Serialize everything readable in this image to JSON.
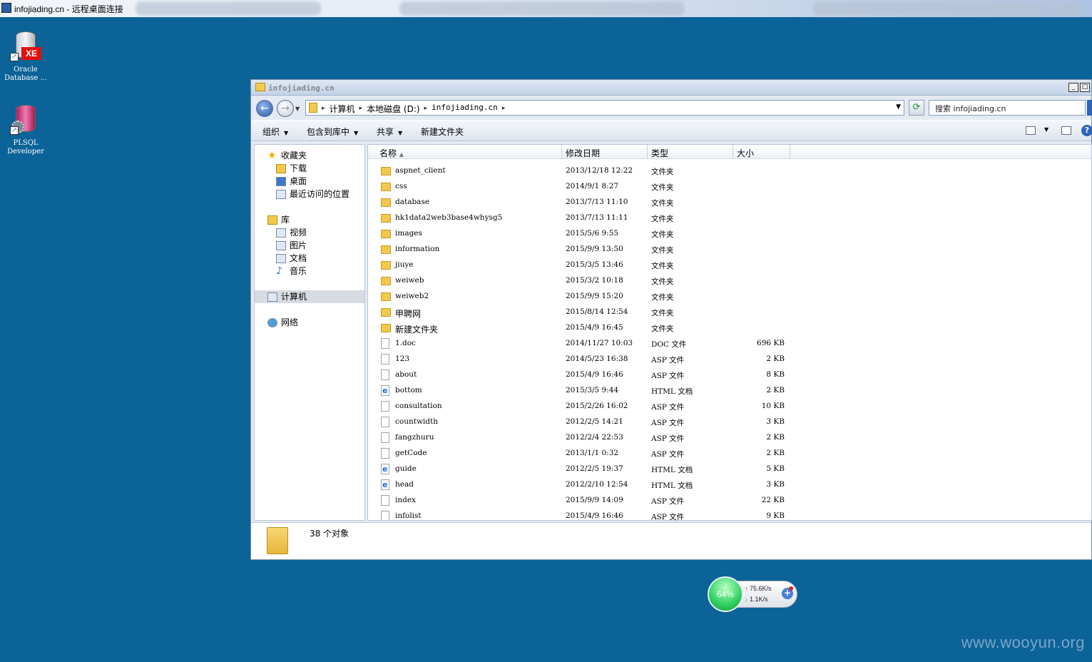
{
  "rdp": {
    "title": "infojiading.cn - 远程桌面连接"
  },
  "desktop": {
    "icons": [
      {
        "label_line1": "Oracle",
        "label_line2": "Database ...",
        "icon": "oracle-xe-icon"
      },
      {
        "label_line1": "PLSQL",
        "label_line2": "Developer",
        "icon": "plsql-developer-icon"
      }
    ]
  },
  "explorer": {
    "title": "infojiading.cn",
    "breadcrumb": [
      "计算机",
      "本地磁盘 (D:)",
      "infojiading.cn"
    ],
    "search_placeholder": "搜索 infojiading.cn",
    "toolbar": {
      "organize": "组织",
      "include_library": "包含到库中",
      "share": "共享",
      "new_folder": "新建文件夹"
    },
    "nav": {
      "favorites": "收藏夹",
      "downloads": "下载",
      "desktop": "桌面",
      "recent": "最近访问的位置",
      "libraries": "库",
      "videos": "视频",
      "pictures": "图片",
      "documents": "文档",
      "music": "音乐",
      "computer": "计算机",
      "network": "网络"
    },
    "columns": {
      "name": "名称",
      "date": "修改日期",
      "type": "类型",
      "size": "大小"
    },
    "files": [
      {
        "name": "aspnet_client",
        "date": "2013/12/18 12:22",
        "type": "文件夹",
        "size": "",
        "kind": "folder"
      },
      {
        "name": "css",
        "date": "2014/9/1 8:27",
        "type": "文件夹",
        "size": "",
        "kind": "folder"
      },
      {
        "name": "database",
        "date": "2013/7/13 11:10",
        "type": "文件夹",
        "size": "",
        "kind": "folder"
      },
      {
        "name": "hk1data2web3base4whysg5",
        "date": "2013/7/13 11:11",
        "type": "文件夹",
        "size": "",
        "kind": "folder"
      },
      {
        "name": "images",
        "date": "2015/5/6 9:55",
        "type": "文件夹",
        "size": "",
        "kind": "folder"
      },
      {
        "name": "information",
        "date": "2015/9/9 13:50",
        "type": "文件夹",
        "size": "",
        "kind": "folder"
      },
      {
        "name": "jiuye",
        "date": "2015/3/5 13:46",
        "type": "文件夹",
        "size": "",
        "kind": "folder"
      },
      {
        "name": "weiweb",
        "date": "2015/3/2 10:18",
        "type": "文件夹",
        "size": "",
        "kind": "folder"
      },
      {
        "name": "weiweb2",
        "date": "2015/9/9 15:20",
        "type": "文件夹",
        "size": "",
        "kind": "folder"
      },
      {
        "name": "甲聘网",
        "date": "2015/8/14 12:54",
        "type": "文件夹",
        "size": "",
        "kind": "folder"
      },
      {
        "name": "新建文件夹",
        "date": "2015/4/9 16:45",
        "type": "文件夹",
        "size": "",
        "kind": "folder"
      },
      {
        "name": "1.doc",
        "date": "2014/11/27 10:03",
        "type": "DOC 文件",
        "size": "696 KB",
        "kind": "file"
      },
      {
        "name": "123",
        "date": "2014/5/23 16:38",
        "type": "ASP 文件",
        "size": "2 KB",
        "kind": "file"
      },
      {
        "name": "about",
        "date": "2015/4/9 16:46",
        "type": "ASP 文件",
        "size": "8 KB",
        "kind": "file"
      },
      {
        "name": "bottom",
        "date": "2015/3/5 9:44",
        "type": "HTML 文档",
        "size": "2 KB",
        "kind": "html"
      },
      {
        "name": "consultation",
        "date": "2015/2/26 16:02",
        "type": "ASP 文件",
        "size": "10 KB",
        "kind": "file"
      },
      {
        "name": "countwidth",
        "date": "2012/2/5 14:21",
        "type": "ASP 文件",
        "size": "3 KB",
        "kind": "file"
      },
      {
        "name": "fangzhuru",
        "date": "2012/2/4 22:53",
        "type": "ASP 文件",
        "size": "2 KB",
        "kind": "file"
      },
      {
        "name": "getCode",
        "date": "2013/1/1 0:32",
        "type": "ASP 文件",
        "size": "2 KB",
        "kind": "file"
      },
      {
        "name": "guide",
        "date": "2012/2/5 19:37",
        "type": "HTML 文档",
        "size": "5 KB",
        "kind": "html"
      },
      {
        "name": "head",
        "date": "2012/2/10 12:54",
        "type": "HTML 文档",
        "size": "3 KB",
        "kind": "html"
      },
      {
        "name": "index",
        "date": "2015/9/9 14:09",
        "type": "ASP 文件",
        "size": "22 KB",
        "kind": "file"
      },
      {
        "name": "infolist",
        "date": "2015/4/9 16:46",
        "type": "ASP 文件",
        "size": "9 KB",
        "kind": "file"
      }
    ],
    "status_count": "38 个对象"
  },
  "net_widget": {
    "percent": "64%",
    "up": "75.6K/s",
    "down": "1.1K/s"
  },
  "watermark": "www.wooyun.org",
  "colors": {
    "desktop": "#0b6398",
    "folder": "#f2c94c"
  }
}
